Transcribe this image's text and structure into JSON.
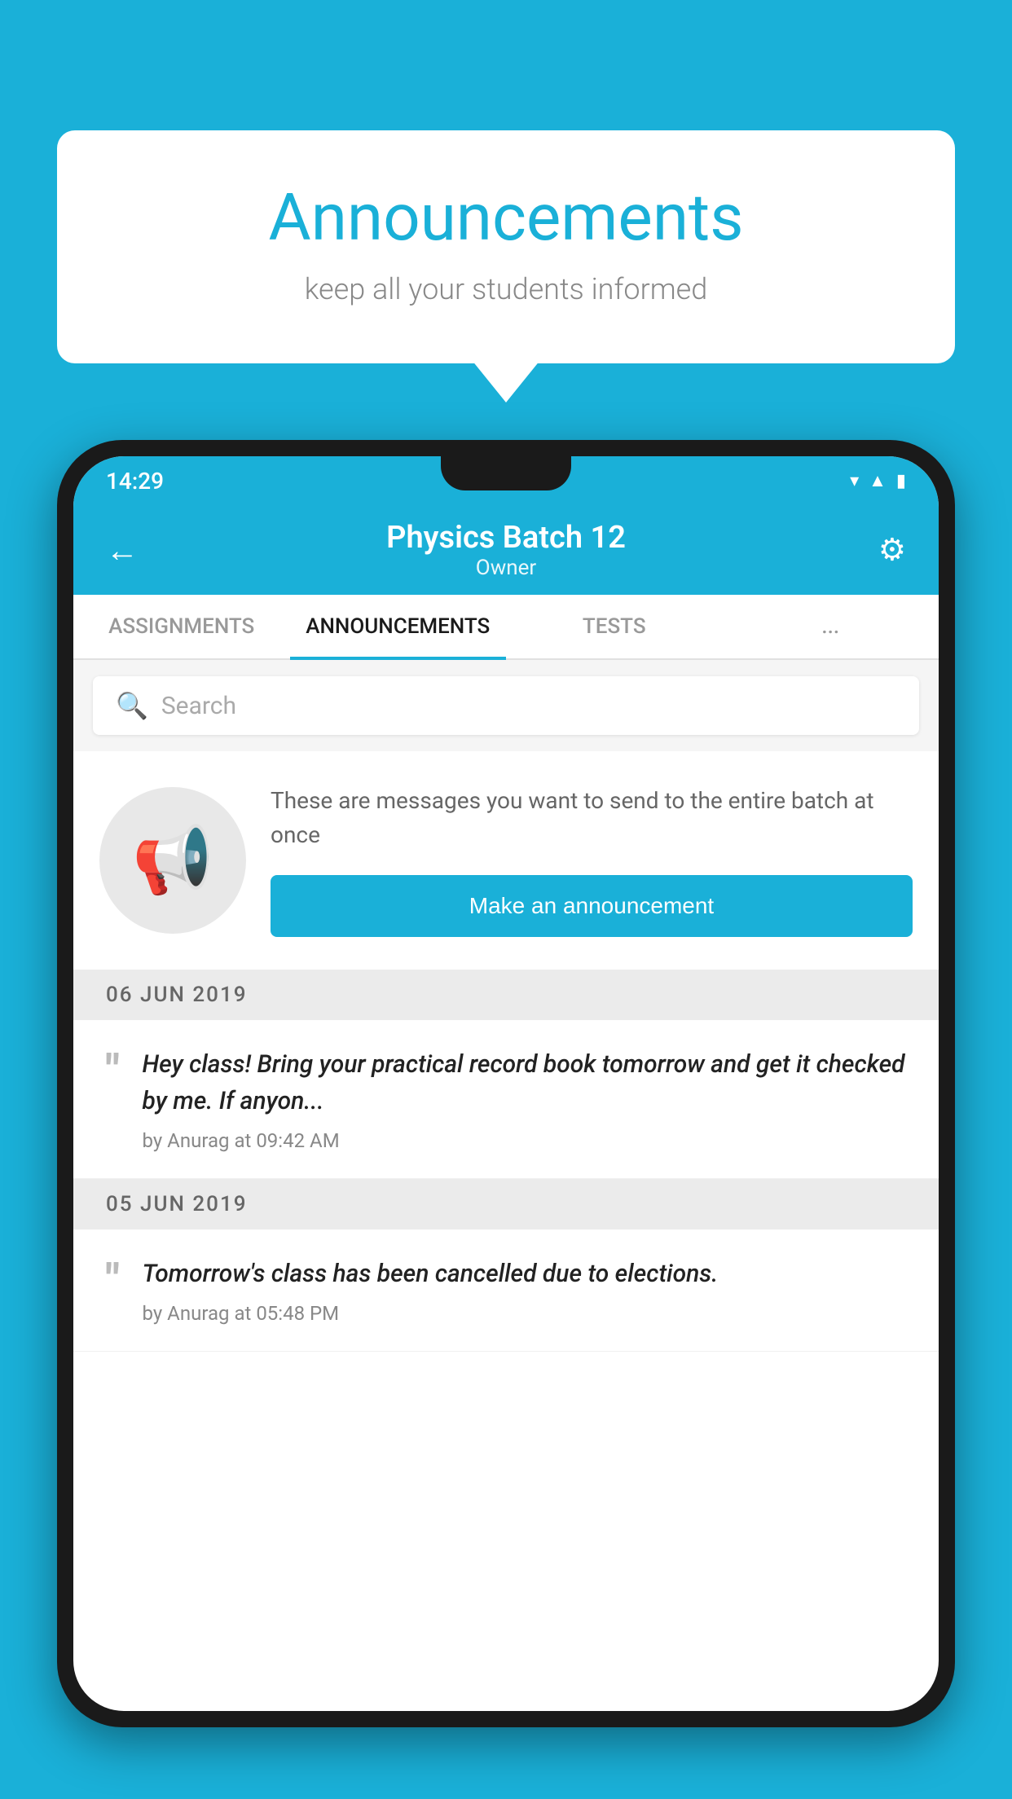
{
  "background_color": "#1ab0d8",
  "speech_bubble": {
    "title": "Announcements",
    "subtitle": "keep all your students informed"
  },
  "status_bar": {
    "time": "14:29",
    "icons": [
      "wifi",
      "signal",
      "battery"
    ]
  },
  "app_bar": {
    "title": "Physics Batch 12",
    "subtitle": "Owner",
    "back_label": "←",
    "settings_label": "⚙"
  },
  "tabs": [
    {
      "label": "ASSIGNMENTS",
      "active": false
    },
    {
      "label": "ANNOUNCEMENTS",
      "active": true
    },
    {
      "label": "TESTS",
      "active": false
    },
    {
      "label": "...",
      "active": false
    }
  ],
  "search": {
    "placeholder": "Search"
  },
  "promo": {
    "description": "These are messages you want to send to the entire batch at once",
    "button_label": "Make an announcement"
  },
  "announcements": [
    {
      "date": "06  JUN  2019",
      "text": "Hey class! Bring your practical record book tomorrow and get it checked by me. If anyon...",
      "meta": "by Anurag at 09:42 AM"
    },
    {
      "date": "05  JUN  2019",
      "text": "Tomorrow's class has been cancelled due to elections.",
      "meta": "by Anurag at 05:48 PM"
    }
  ]
}
